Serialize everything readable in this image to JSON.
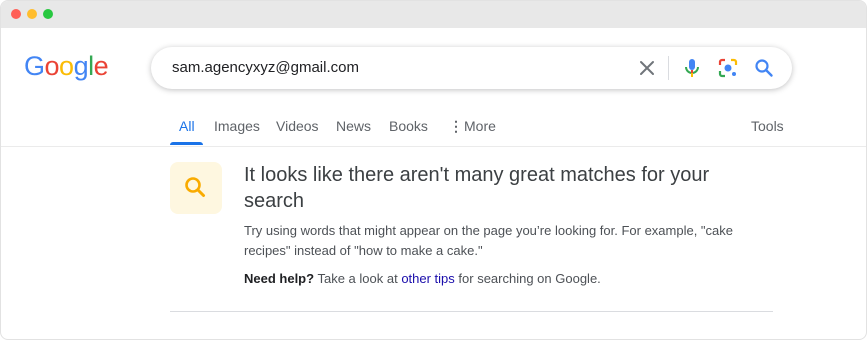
{
  "window": {
    "controls": [
      "close",
      "minimize",
      "zoom"
    ]
  },
  "logo": {
    "letters": [
      "G",
      "o",
      "o",
      "g",
      "l",
      "e"
    ],
    "colors": [
      "#4285F4",
      "#EA4335",
      "#FBBC05",
      "#4285F4",
      "#34A853",
      "#EA4335"
    ]
  },
  "search": {
    "value": "sam.agencyxyz@gmail.com",
    "icons": [
      "close-icon",
      "microphone-icon",
      "lens-icon",
      "search-icon"
    ]
  },
  "tabs": {
    "items": [
      {
        "label": "All",
        "active": true
      },
      {
        "label": "Images"
      },
      {
        "label": "Videos"
      },
      {
        "label": "News"
      },
      {
        "label": "Books"
      },
      {
        "label": "More",
        "icon": "more-vert-icon"
      }
    ],
    "tools_label": "Tools"
  },
  "notice": {
    "icon": "search-icon",
    "title": "It looks like there aren't many great matches for your search",
    "text": "Try using words that might appear on the page you’re looking for. For example, \"cake recipes\" instead of \"how to make a cake.\"",
    "help": {
      "label": "Need help?",
      "text_before": "Take a look at",
      "link": "other tips",
      "text_after": "for searching on Google."
    }
  },
  "colors": {
    "accent": "#1a73e8",
    "link": "#1a0dab",
    "notice_icon_bg": "#fef7e0",
    "notice_icon_fg": "#f9ab00"
  }
}
